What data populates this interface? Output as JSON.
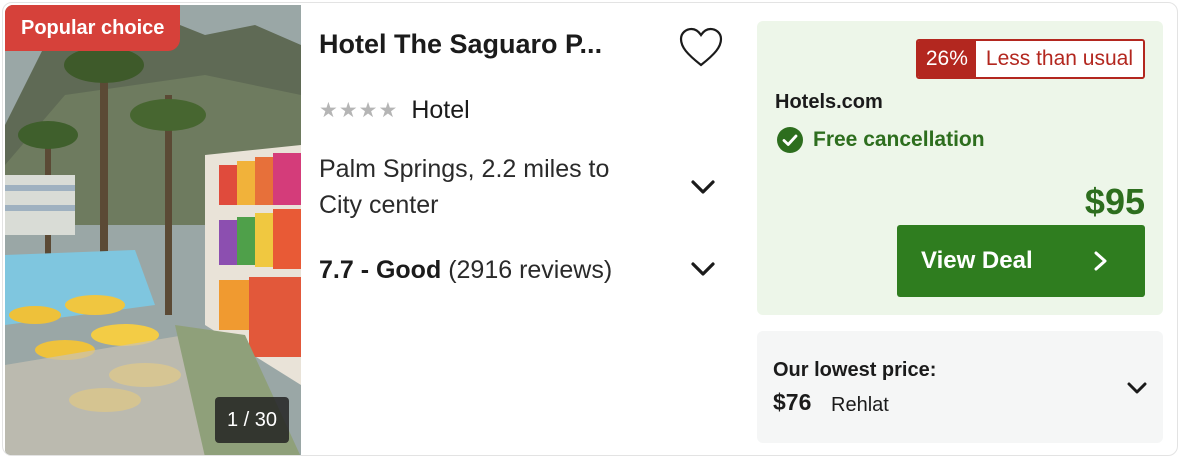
{
  "badge": "Popular choice",
  "photo": {
    "counter": "1 / 30"
  },
  "hotel": {
    "name": "Hotel The Saguaro P...",
    "stars": 4,
    "type": "Hotel",
    "location": "Palm Springs, 2.2 miles to City center",
    "rating_score": "7.7 - Good",
    "rating_reviews": "(2916 reviews)"
  },
  "deal": {
    "discount_pct": "26%",
    "discount_label": "Less than usual",
    "provider": "Hotels.com",
    "free_cancellation": "Free cancellation",
    "price": "$95",
    "button_label": "View Deal"
  },
  "lowest": {
    "label": "Our lowest price:",
    "price": "$76",
    "provider": "Rehlat"
  },
  "colors": {
    "badge_red": "#d6413a",
    "discount_red": "#b3271f",
    "deal_green": "#2f7d1f",
    "price_green": "#2d6e1e",
    "deal_bg": "#edf6e9"
  },
  "icons": [
    "heart-icon",
    "star-icon",
    "chevron-down-icon",
    "check-circle-icon",
    "chevron-right-icon"
  ]
}
